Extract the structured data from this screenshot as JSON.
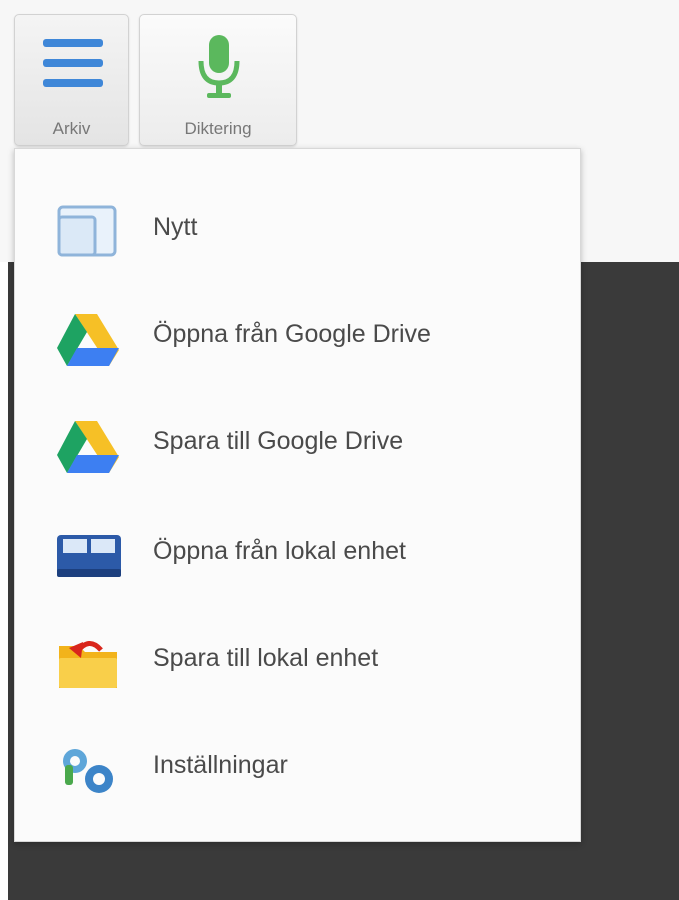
{
  "toolbar": {
    "arkiv_label": "Arkiv",
    "diktering_label": "Diktering"
  },
  "menu": {
    "items": [
      {
        "label": "Nytt",
        "icon": "new-document-icon"
      },
      {
        "label": "Öppna från Google Drive",
        "icon": "google-drive-icon"
      },
      {
        "label": "Spara till Google Drive",
        "icon": "google-drive-icon"
      },
      {
        "label": "Öppna från lokal enhet",
        "icon": "local-device-icon"
      },
      {
        "label": "Spara till lokal enhet",
        "icon": "folder-save-icon"
      },
      {
        "label": "Inställningar",
        "icon": "settings-icon"
      }
    ]
  },
  "colors": {
    "accent": "#3f87d8",
    "mic_green": "#5bb85d",
    "menu_background": "#fbfbfb",
    "dark_background": "#3a3a3a"
  }
}
